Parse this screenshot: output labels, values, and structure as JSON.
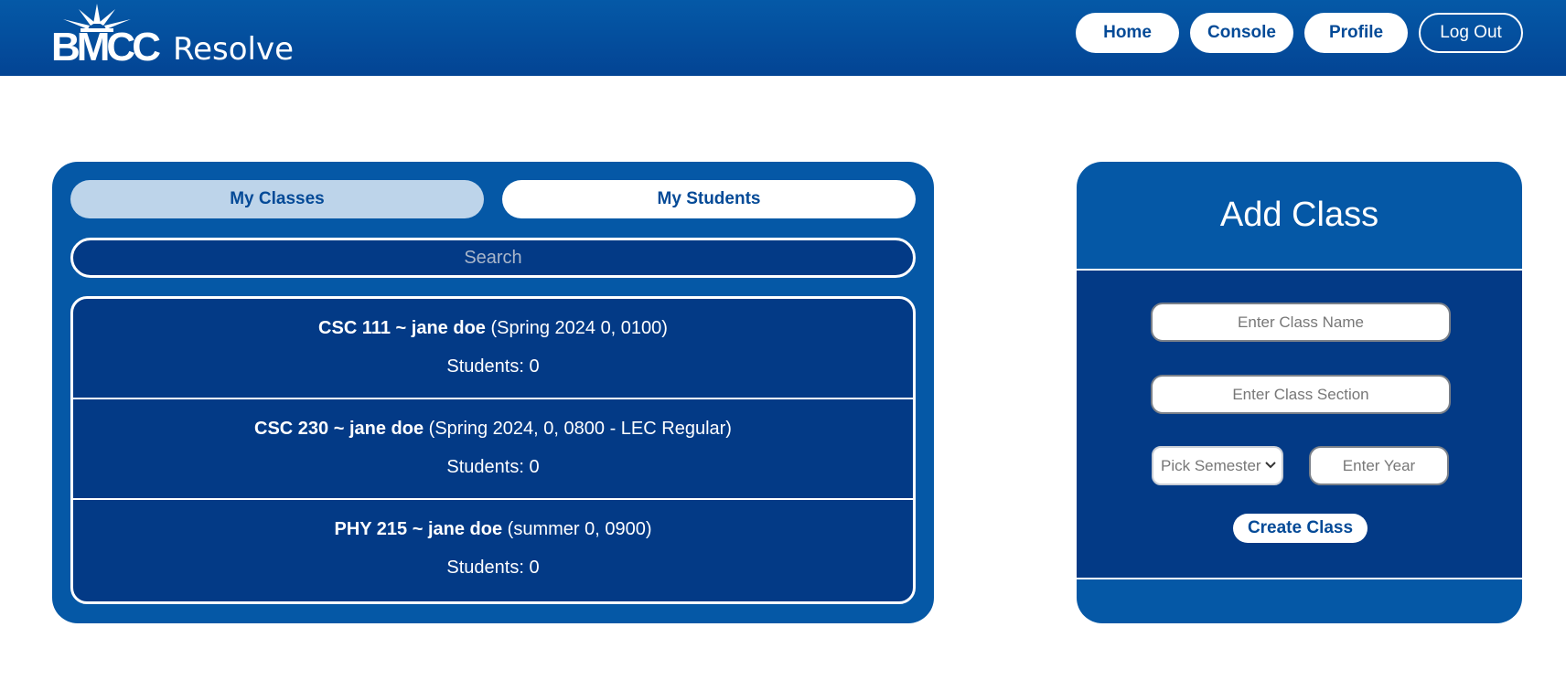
{
  "brand": {
    "logo_text": "BMCC",
    "product": "Resolve"
  },
  "nav": {
    "items": [
      {
        "label": "Home"
      },
      {
        "label": "Console"
      },
      {
        "label": "Profile"
      },
      {
        "label": "Log Out"
      }
    ]
  },
  "classes_panel": {
    "tabs": [
      {
        "label": "My Classes",
        "active": true
      },
      {
        "label": "My Students",
        "active": false
      }
    ],
    "search": {
      "placeholder": "Search",
      "value": ""
    },
    "items": [
      {
        "title": "CSC 111 ~ jane doe",
        "details": "(Spring 2024 0, 0100)",
        "students": "Students: 0"
      },
      {
        "title": "CSC 230 ~ jane doe",
        "details": "(Spring 2024, 0, 0800 - LEC Regular)",
        "students": "Students: 0"
      },
      {
        "title": "PHY 215 ~ jane doe",
        "details": "(summer 0, 0900)",
        "students": "Students: 0"
      }
    ]
  },
  "add_class": {
    "title": "Add Class",
    "class_name_placeholder": "Enter Class Name",
    "class_section_placeholder": "Enter Class Section",
    "semester_select": "Pick Semester",
    "year_placeholder": "Enter Year",
    "create_label": "Create Class"
  },
  "colors": {
    "header": "#0559a7",
    "panel": "#0558a6",
    "panel_dark": "#033a86",
    "active_tab": "#bdd4ea",
    "accent_text": "#044a97"
  }
}
